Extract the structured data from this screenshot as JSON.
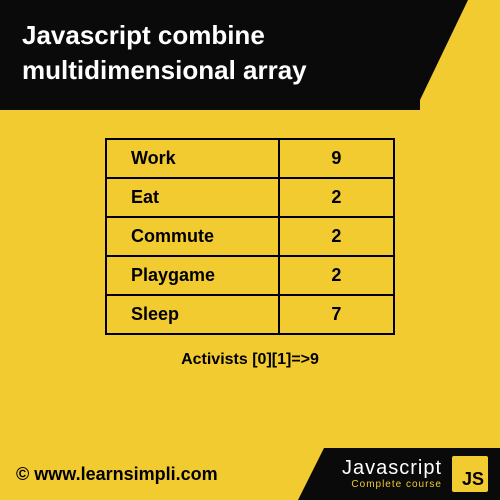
{
  "header": {
    "title": "Javascript combine multidimensional array"
  },
  "table": {
    "rows": [
      {
        "label": "Work",
        "value": "9"
      },
      {
        "label": "Eat",
        "value": "2"
      },
      {
        "label": "Commute",
        "value": "2"
      },
      {
        "label": "Playgame",
        "value": "2"
      },
      {
        "label": "Sleep",
        "value": "7"
      }
    ],
    "caption": "Activists [0][1]=>9"
  },
  "footer": {
    "site": "© www.learnsimpli.com",
    "badge_main": "Javascript",
    "badge_sub": "Complete course",
    "logo_text": "JS"
  }
}
